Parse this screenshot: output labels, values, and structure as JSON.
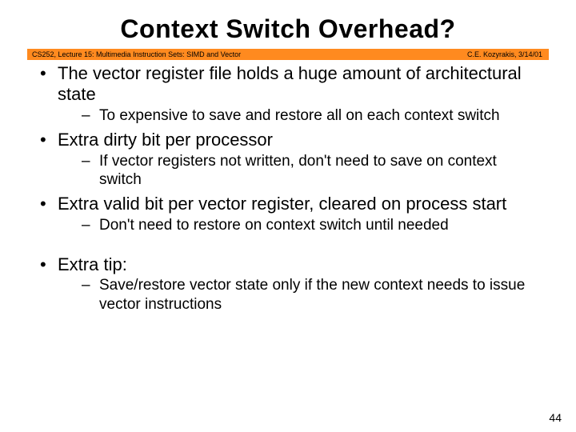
{
  "title": "Context Switch Overhead?",
  "banner": {
    "left": "CS252, Lecture 15: Multimedia Instruction Sets: SIMD and Vector",
    "right": "C.E. Kozyrakis, 3/14/01"
  },
  "bullets": [
    {
      "text": "The vector register file holds a huge amount of architectural state",
      "sub": [
        "To expensive to save and restore all on each context switch"
      ]
    },
    {
      "text": "Extra dirty bit per processor",
      "sub": [
        "If vector registers not written, don't need to save on context switch"
      ]
    },
    {
      "text": "Extra valid  bit per vector register, cleared on process start",
      "sub": [
        "Don't need to restore on context switch until needed"
      ]
    },
    {
      "text": "Extra tip:",
      "sub": [
        "Save/restore vector state only if the new context needs to issue vector instructions"
      ],
      "gapBefore": true
    }
  ],
  "pageNumber": "44"
}
